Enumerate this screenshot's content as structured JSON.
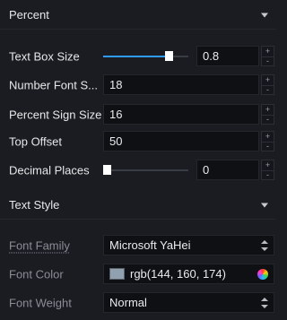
{
  "percent_section": {
    "title": "Percent",
    "text_box_size": {
      "label": "Text Box Size",
      "value": "0.8",
      "slider_level": 0.8
    },
    "number_font_size": {
      "label": "Number Font S...",
      "value": "18"
    },
    "percent_sign_size": {
      "label": "Percent Sign Size",
      "value": "16"
    },
    "top_offset": {
      "label": "Top Offset",
      "value": "50"
    },
    "decimal_places": {
      "label": "Decimal Places",
      "value": "0",
      "slider_level": 0
    }
  },
  "text_style_section": {
    "title": "Text Style",
    "font_family": {
      "label": "Font Family",
      "value": "Microsoft YaHei"
    },
    "font_color": {
      "label": "Font Color",
      "value": "rgb(144, 160, 174)",
      "swatch_color": "#90a0ae"
    },
    "font_weight": {
      "label": "Font Weight",
      "value": "Normal"
    }
  },
  "stepper": {
    "up": "+",
    "down": "-"
  },
  "colors": {
    "background": "#1b1c21",
    "accent": "#2f9bff",
    "input_bg": "#0f1014"
  }
}
